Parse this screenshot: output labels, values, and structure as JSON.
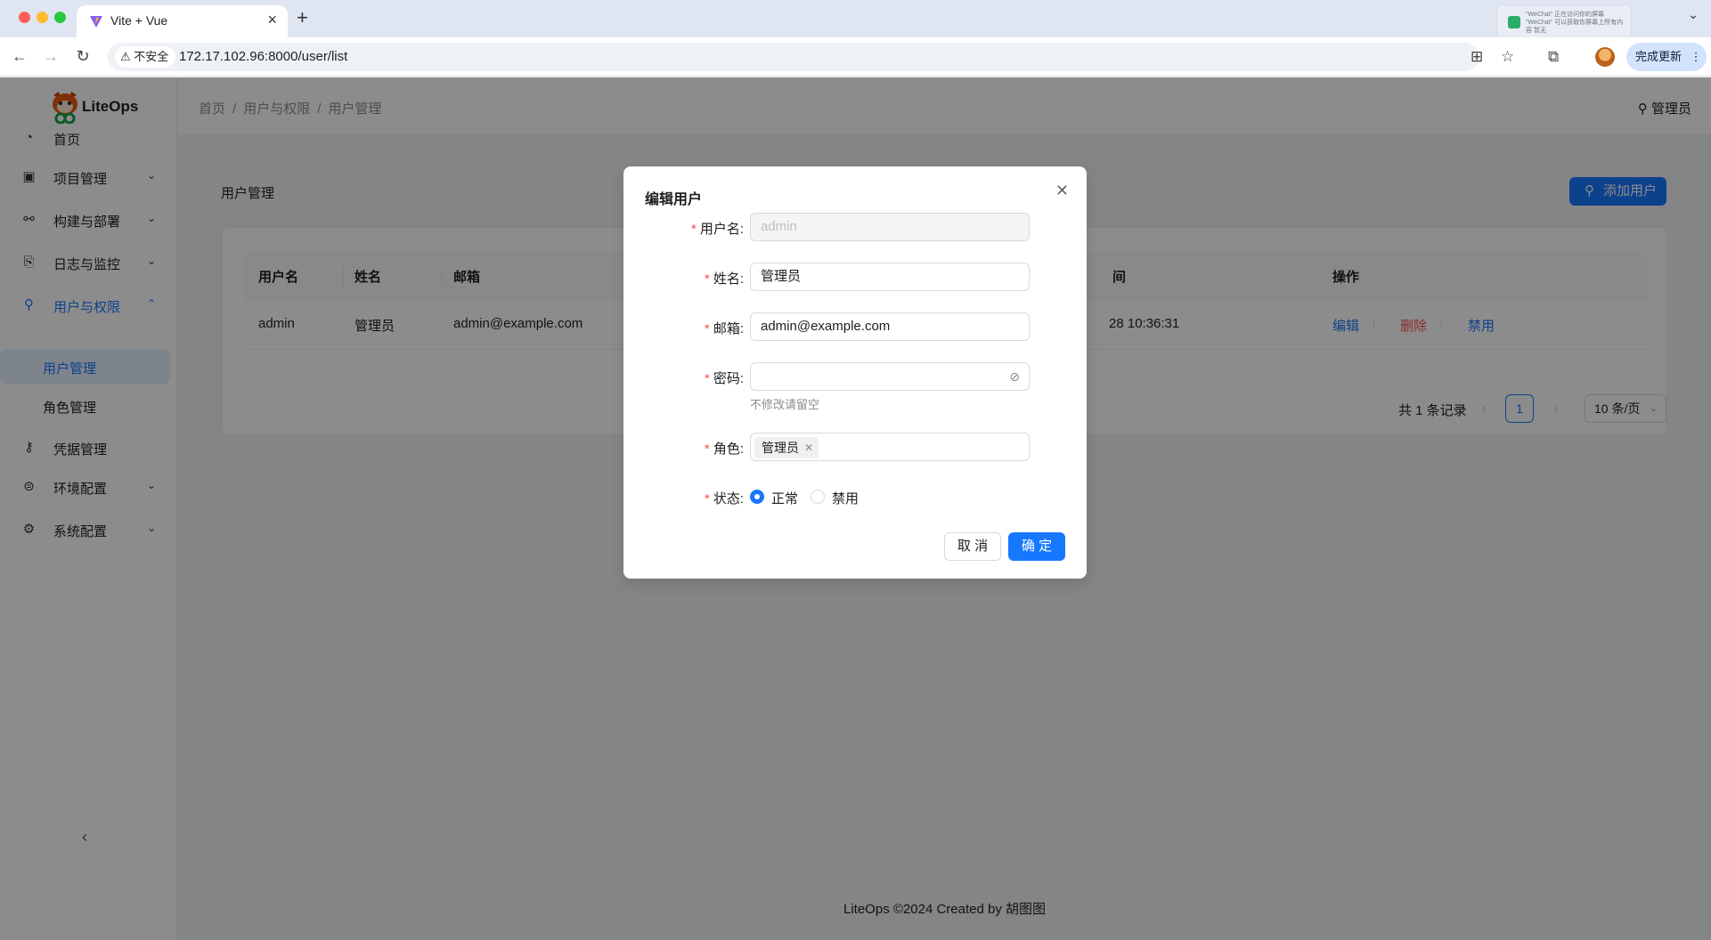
{
  "browser": {
    "tab_title": "Vite + Vue",
    "new_tab": "+",
    "url": "172.17.102.96:8000/user/list",
    "security_label": "不安全",
    "update_button": "完成更新",
    "notification": "\"WeChat\" 正在访问你的屏幕 \"WeChat\" 可以获取你屏幕上所有内容 暂无"
  },
  "sidebar": {
    "logo_text": "LiteOps",
    "items": [
      {
        "label": "首页",
        "icon": "dashboard-icon"
      },
      {
        "label": "项目管理",
        "icon": "project-icon"
      },
      {
        "label": "构建与部署",
        "icon": "deploy-icon"
      },
      {
        "label": "日志与监控",
        "icon": "log-icon"
      },
      {
        "label": "用户与权限",
        "icon": "user-icon"
      },
      {
        "label": "凭据管理",
        "icon": "key-icon"
      },
      {
        "label": "环境配置",
        "icon": "environment-icon"
      },
      {
        "label": "系统配置",
        "icon": "settings-icon"
      }
    ],
    "sub_items": [
      "用户管理",
      "角色管理"
    ]
  },
  "header": {
    "breadcrumb": [
      "首页",
      "用户与权限",
      "用户管理"
    ],
    "user": "管理员"
  },
  "page": {
    "title": "用户管理",
    "add_button": "添加用户"
  },
  "table": {
    "columns": [
      "用户名",
      "姓名",
      "邮箱",
      "间",
      "操作"
    ],
    "rows": [
      {
        "username": "admin",
        "name": "管理员",
        "email": "admin@example.com",
        "time": "28 10:36:31",
        "actions": [
          "编辑",
          "删除",
          "禁用"
        ]
      }
    ]
  },
  "pagination": {
    "total": "共 1 条记录",
    "current": "1",
    "page_size": "10 条/页"
  },
  "footer": "LiteOps ©2024 Created by 胡图图",
  "modal": {
    "title": "编辑用户",
    "fields": {
      "username_label": "用户名",
      "username_value": "admin",
      "name_label": "姓名",
      "name_value": "管理员",
      "email_label": "邮箱",
      "email_value": "admin@example.com",
      "password_label": "密码",
      "password_value": "",
      "password_hint": "不修改请留空",
      "role_label": "角色",
      "role_tag": "管理员",
      "status_label": "状态",
      "status_options": [
        "正常",
        "禁用"
      ],
      "status_selected": "正常"
    },
    "cancel": "取 消",
    "ok": "确 定"
  },
  "colors": {
    "primary": "#1677ff",
    "danger": "#ff4d4f"
  }
}
